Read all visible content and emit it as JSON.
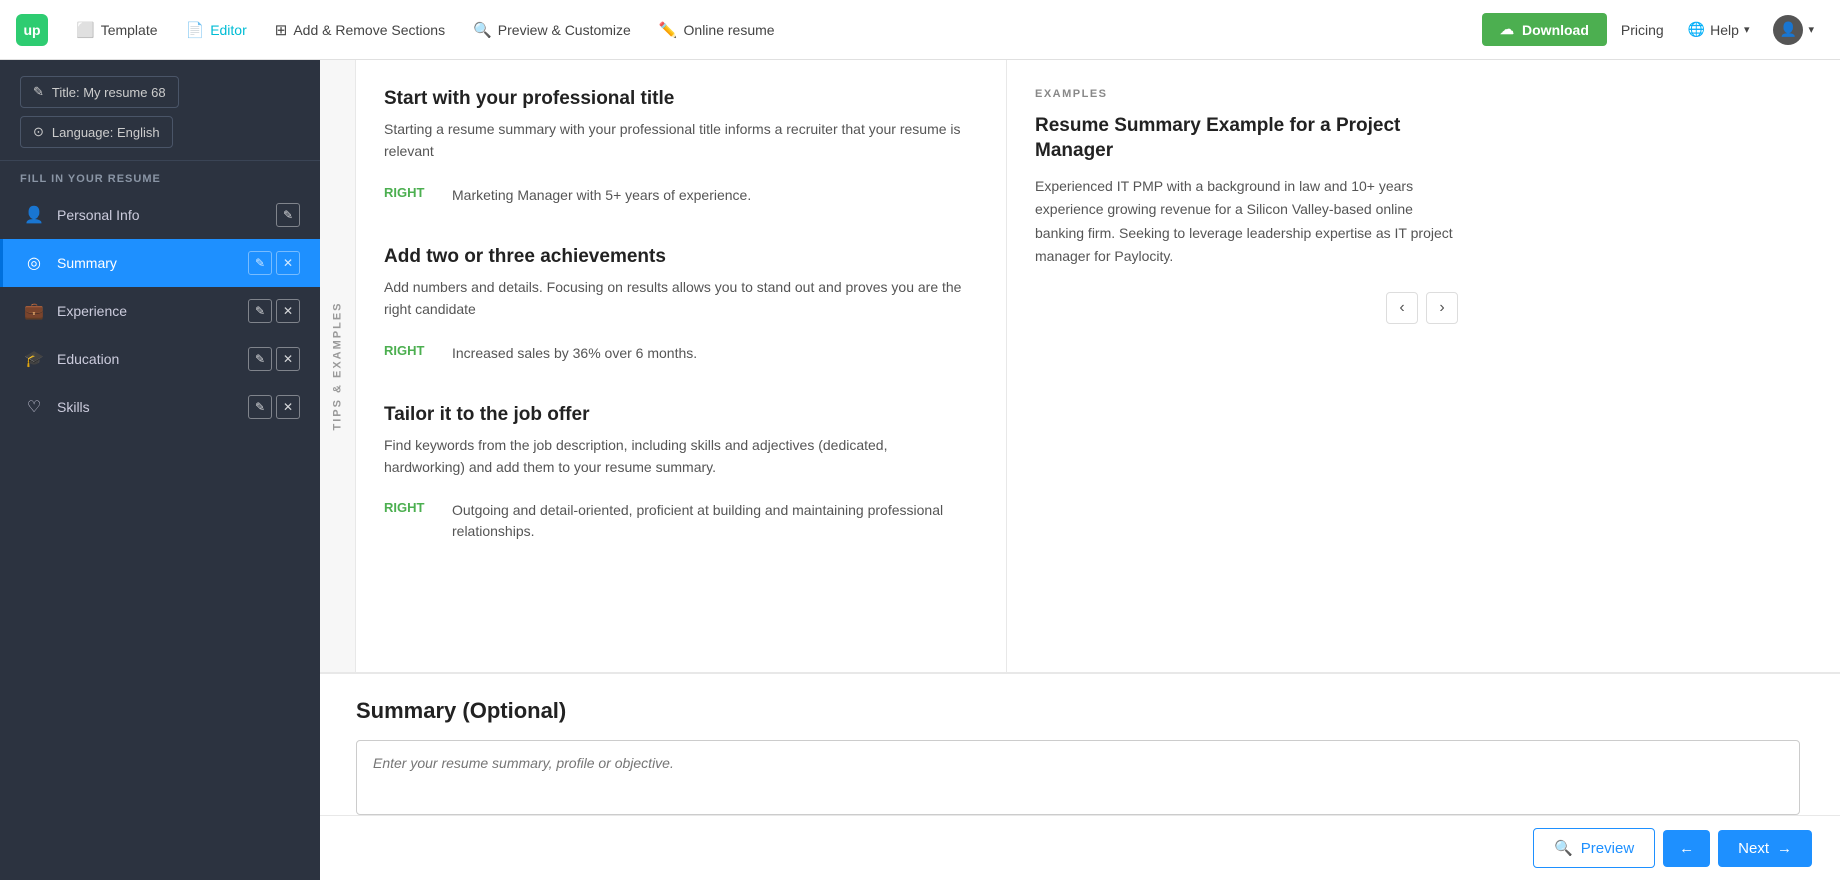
{
  "logo": {
    "text": "up"
  },
  "topnav": {
    "items": [
      {
        "id": "template",
        "label": "Template",
        "icon": "⬜",
        "active": false
      },
      {
        "id": "editor",
        "label": "Editor",
        "icon": "📄",
        "active": true
      },
      {
        "id": "add-remove",
        "label": "Add & Remove Sections",
        "icon": "⊞",
        "active": false
      },
      {
        "id": "preview-customize",
        "label": "Preview & Customize",
        "icon": "🔍",
        "active": false
      },
      {
        "id": "online-resume",
        "label": "Online resume",
        "icon": "✏️",
        "active": false
      }
    ],
    "download_label": "Download",
    "pricing_label": "Pricing",
    "help_label": "Help",
    "help_caret": "▾"
  },
  "sidebar": {
    "title_btn": "Title: My resume 68",
    "language_btn": "Language: English",
    "fill_label": "Fill in your resume",
    "nav_items": [
      {
        "id": "personal-info",
        "label": "Personal Info",
        "icon": "👤",
        "active": false,
        "has_actions": true
      },
      {
        "id": "summary",
        "label": "Summary",
        "icon": "◎",
        "active": true,
        "has_actions": true
      },
      {
        "id": "experience",
        "label": "Experience",
        "icon": "💼",
        "active": false,
        "has_actions": true
      },
      {
        "id": "education",
        "label": "Education",
        "icon": "🎓",
        "active": false,
        "has_actions": true
      },
      {
        "id": "skills",
        "label": "Skills",
        "icon": "♡",
        "active": false,
        "has_actions": true
      }
    ]
  },
  "tips_label": "TIPS & EXAMPLES",
  "tips": [
    {
      "id": "tip1",
      "title": "Start with your professional title",
      "desc": "Starting a resume summary with your professional title informs a recruiter that your resume is relevant",
      "right_label": "RIGHT",
      "example_text": "Marketing Manager with 5+ years of experience."
    },
    {
      "id": "tip2",
      "title": "Add two or three achievements",
      "desc": "Add numbers and details. Focusing on results allows you to stand out and proves you are the right candidate",
      "right_label": "RIGHT",
      "example_text": "Increased sales by 36% over 6 months."
    },
    {
      "id": "tip3",
      "title": "Tailor it to the job offer",
      "desc": "Find keywords from the job description, including skills and adjectives (dedicated, hardworking) and add them to your resume summary.",
      "right_label": "RIGHT",
      "example_text": "Outgoing and detail-oriented, proficient at building and maintaining professional relationships."
    }
  ],
  "examples": {
    "section_label": "EXAMPLES",
    "card_title": "Resume Summary Example for a Project Manager",
    "card_text": "Experienced IT PMP with a background in law and 10+ years experience growing revenue for a Silicon Valley-based online banking firm. Seeking to leverage leadership expertise as IT project manager for Paylocity.",
    "prev_btn": "‹",
    "next_btn": "›"
  },
  "summary_form": {
    "title": "Summary (Optional)",
    "placeholder": "Enter your resume summary, profile or objective."
  },
  "bottom_bar": {
    "preview_label": "Preview",
    "preview_icon": "🔍",
    "back_icon": "←",
    "next_label": "Next",
    "next_icon": "→"
  }
}
